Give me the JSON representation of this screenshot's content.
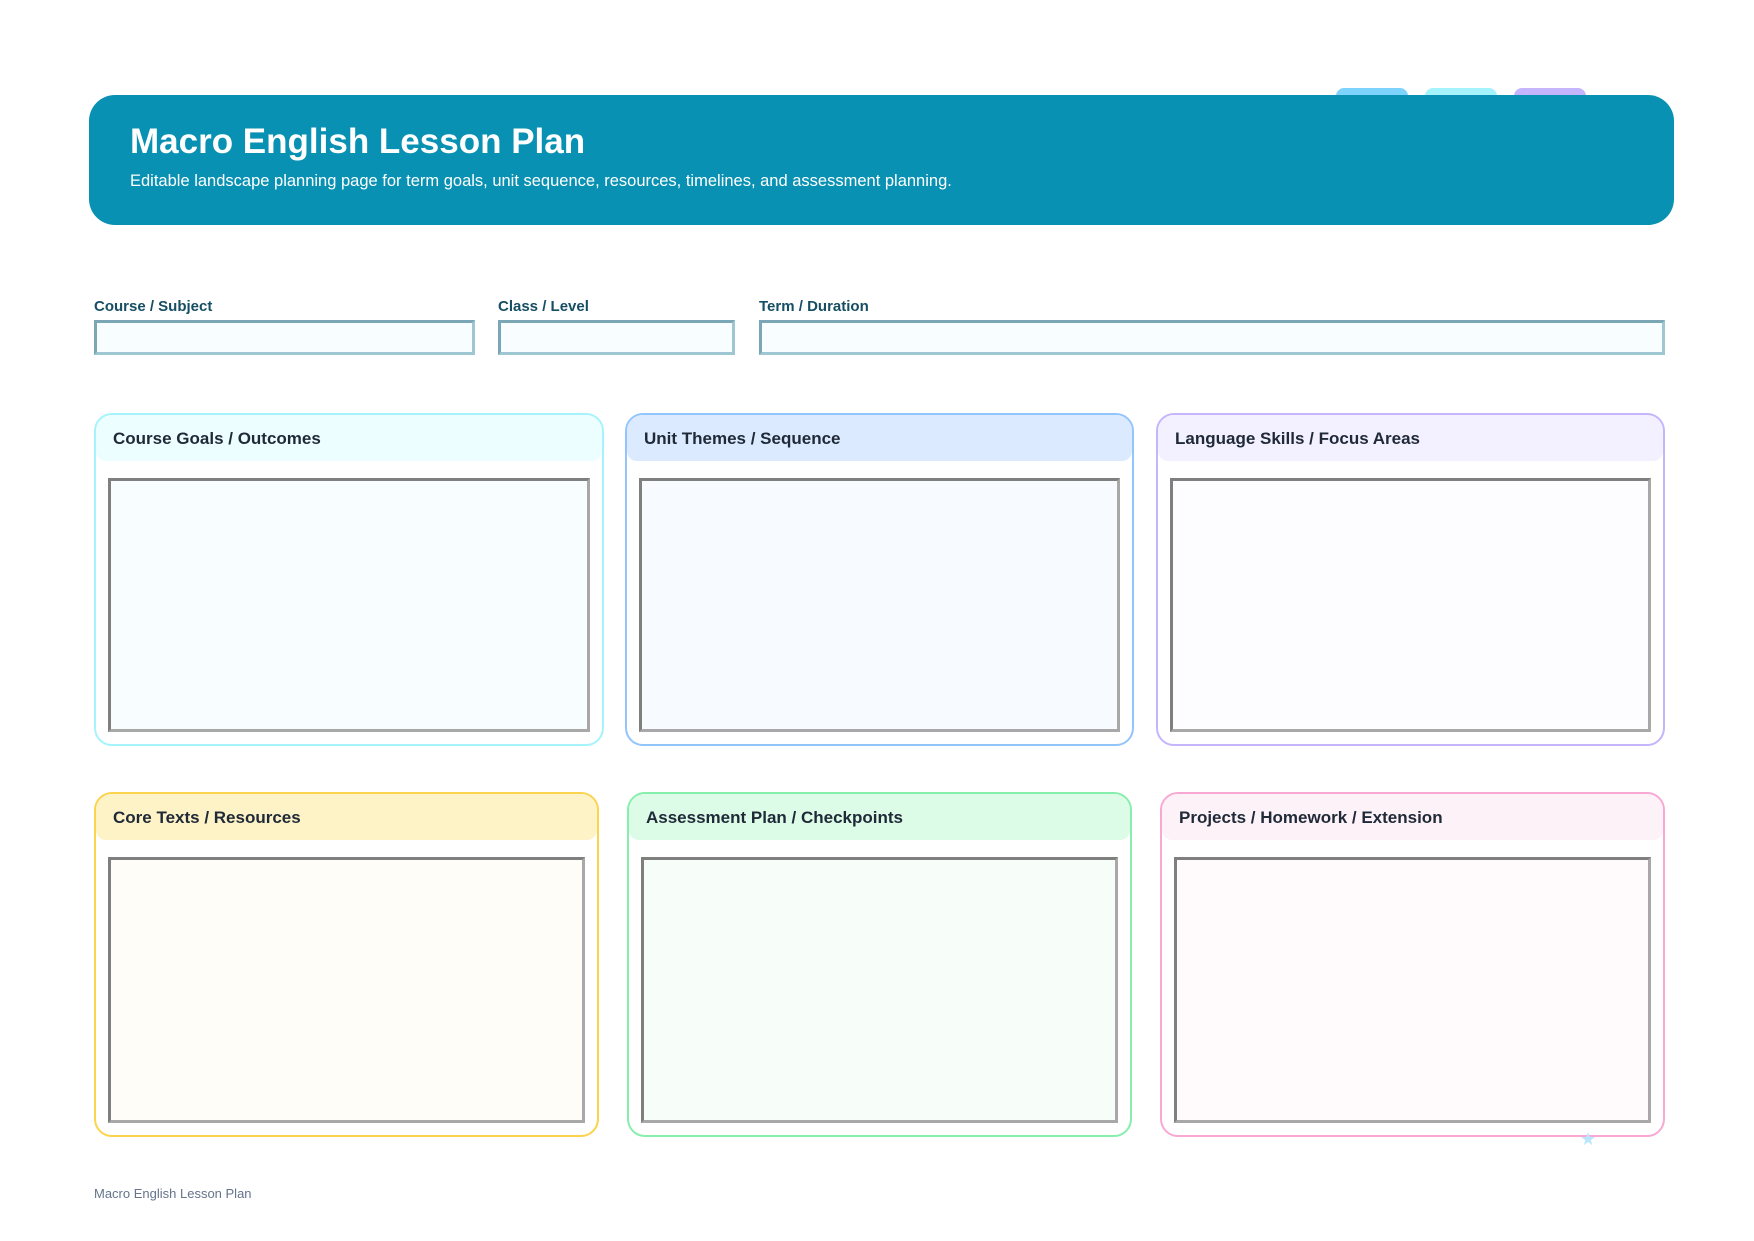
{
  "header": {
    "title": "Macro English Lesson Plan",
    "subtitle": "Editable landscape planning page for term goals, unit sequence, resources, timelines, and assessment planning."
  },
  "fields": {
    "course": {
      "label": "Course / Subject",
      "value": ""
    },
    "class": {
      "label": "Class / Level",
      "value": ""
    },
    "term": {
      "label": "Term / Duration",
      "value": ""
    }
  },
  "panels": {
    "goals": {
      "title": "Course Goals / Outcomes",
      "value": ""
    },
    "themes": {
      "title": "Unit Themes / Sequence",
      "value": ""
    },
    "skills": {
      "title": "Language Skills / Focus Areas",
      "value": ""
    },
    "resources": {
      "title": "Core Texts / Resources",
      "value": ""
    },
    "assessment": {
      "title": "Assessment Plan / Checkpoints",
      "value": ""
    },
    "projects": {
      "title": "Projects / Homework / Extension",
      "value": ""
    }
  },
  "footer": {
    "text": "Macro English Lesson Plan"
  },
  "decor": {
    "star_icon": "star-icon",
    "star_glyph": "★"
  },
  "colors": {
    "header_bg": "#0891b2",
    "tab_blue": "#7dd3fc",
    "tab_cyan": "#a5f3fc",
    "tab_purple": "#c4b5fd",
    "goals_border": "#a5f3fc",
    "goals_head": "#ecfeff",
    "goals_fill": "#f8feff",
    "themes_border": "#93c5fd",
    "themes_head": "#dbeafe",
    "themes_fill": "#f7fbff",
    "skills_border": "#c4b5fd",
    "skills_head": "#f3f0ff",
    "skills_fill": "#fdfcff",
    "resources_border": "#fcd34d",
    "resources_head": "#fef3c7",
    "resources_fill": "#fffdf7",
    "assessment_border": "#86efac",
    "assessment_head": "#dcfce7",
    "assessment_fill": "#f7fdf9",
    "projects_border": "#f9a8d4",
    "projects_head": "#fdf2f8",
    "projects_fill": "#fffafc",
    "star": "#bae6fd"
  }
}
